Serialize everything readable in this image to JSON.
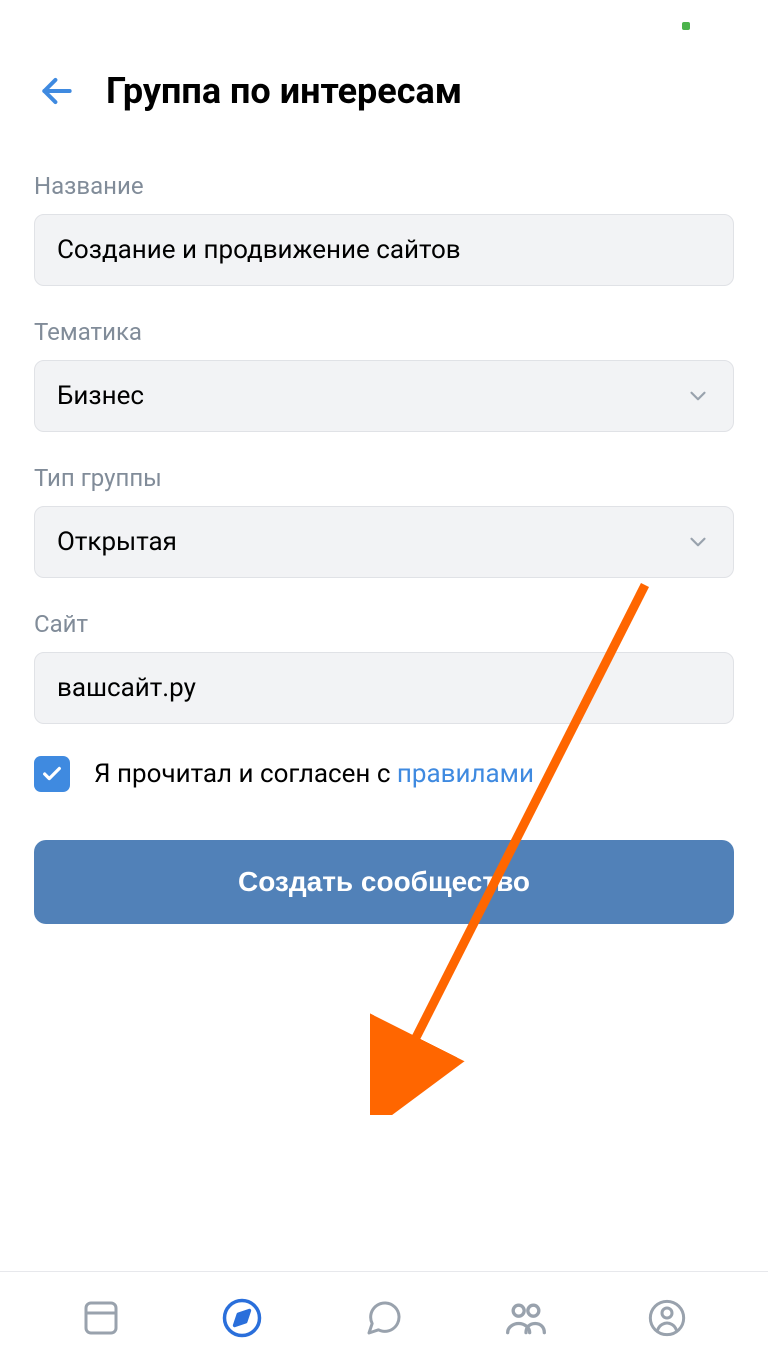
{
  "header": {
    "title": "Группа по интересам"
  },
  "fields": {
    "name": {
      "label": "Название",
      "value": "Создание и продвижение сайтов"
    },
    "topic": {
      "label": "Тематика",
      "value": "Бизнес"
    },
    "groupType": {
      "label": "Тип группы",
      "value": "Открытая"
    },
    "site": {
      "label": "Сайт",
      "value": "вашсайт.ру"
    }
  },
  "agreement": {
    "checked": true,
    "text_prefix": "Я прочитал и согласен с ",
    "link_text": "правилами"
  },
  "button": {
    "submit_label": "Создать сообщество"
  },
  "colors": {
    "accent": "#3f8ae0",
    "button": "#5181b8",
    "input_bg": "#f2f3f5",
    "muted": "#818c99",
    "annotation": "#ff6600"
  }
}
